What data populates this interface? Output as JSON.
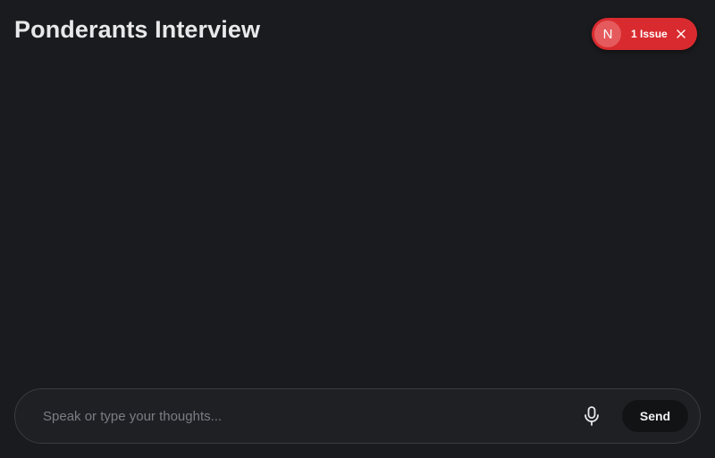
{
  "header": {
    "title": "Ponderants Interview"
  },
  "issue_indicator": {
    "badge_letter": "N",
    "label": "1 Issue",
    "close_icon": "close-icon",
    "color": "#d92b2f"
  },
  "composer": {
    "placeholder": "Speak or type your thoughts...",
    "value": "",
    "mic_icon": "microphone-icon",
    "send_label": "Send"
  },
  "theme": {
    "background": "#1a1b1e",
    "text": "#e8e8ea",
    "border": "#3a3b40"
  }
}
